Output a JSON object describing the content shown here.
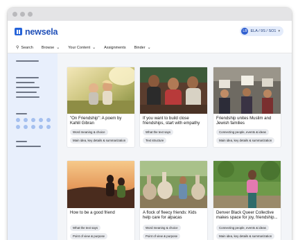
{
  "app": {
    "logo_text": "newsela",
    "user": {
      "avatar_initials": "LB",
      "label": "ELA / 9S / SO1"
    }
  },
  "nav": {
    "items": [
      {
        "label": "Search",
        "icon": "search-icon"
      },
      {
        "label": "Browse",
        "icon": "chevron-down-icon"
      },
      {
        "label": "Your Content",
        "icon": "chevron-down-icon"
      },
      {
        "label": "Assignments",
        "icon": ""
      },
      {
        "label": "Binder",
        "icon": "chevron-down-icon"
      }
    ]
  },
  "colors": {
    "brand": "#2563d9",
    "sidebar_bg": "#e8effc",
    "main_bg": "#f3f5f8",
    "tag_bg": "#e9ebef"
  },
  "cards": [
    {
      "title": "\"On Friendship\": A poem by Kahlil Gibran",
      "tags": [
        "Word meaning & choice",
        "Main idea, key details & summarization"
      ],
      "image": "children-playing-photo"
    },
    {
      "title": "If you want to build close friendships, start with empathy",
      "tags": [
        "What the text says",
        "Text structure"
      ],
      "image": "friends-group-photo"
    },
    {
      "title": "Friendship unites Muslim and Jewish families",
      "tags": [
        "Connecting people, events & ideas",
        "Main idea, key details & summarization"
      ],
      "image": "protest-crowd-photo"
    },
    {
      "title": "How to be a good friend",
      "tags": [
        "What the text says",
        "Point of view & purpose"
      ],
      "image": "sunset-friends-photo"
    },
    {
      "title": "A flock of fleecy friends: Kids help care for alpacas",
      "tags": [
        "Word meaning & choice",
        "Point of view & purpose"
      ],
      "image": "alpacas-photo"
    },
    {
      "title": "Denver Black Queer Collective makes space for joy, friendship...",
      "tags": [
        "Connecting people, events & ideas",
        "Main idea, key details & summarization"
      ],
      "image": "portrait-woman-photo"
    }
  ]
}
